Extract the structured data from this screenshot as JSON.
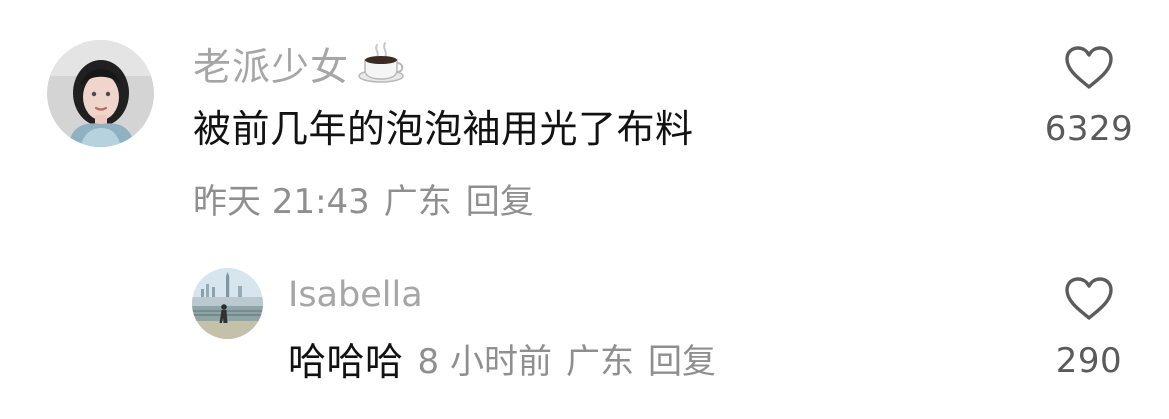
{
  "comment": {
    "username": "老派少女",
    "username_emoji": "coffee-cup-icon",
    "text": "被前几年的泡泡袖用光了布料",
    "time": "昨天 21:43",
    "location": "广东",
    "reply_label": "回复",
    "like_count": "6329"
  },
  "reply": {
    "username": "Isabella",
    "text": "哈哈哈",
    "time": "8 小时前",
    "location": "广东",
    "reply_label": "回复",
    "like_count": "290"
  },
  "icons": {
    "like": "heart-outline-icon",
    "avatar_main": "portrait-avatar",
    "avatar_reply": "seaside-avatar"
  },
  "colors": {
    "username": "#a6a6a6",
    "meta": "#8f8f8f",
    "text": "#121212",
    "like": "#555555"
  }
}
